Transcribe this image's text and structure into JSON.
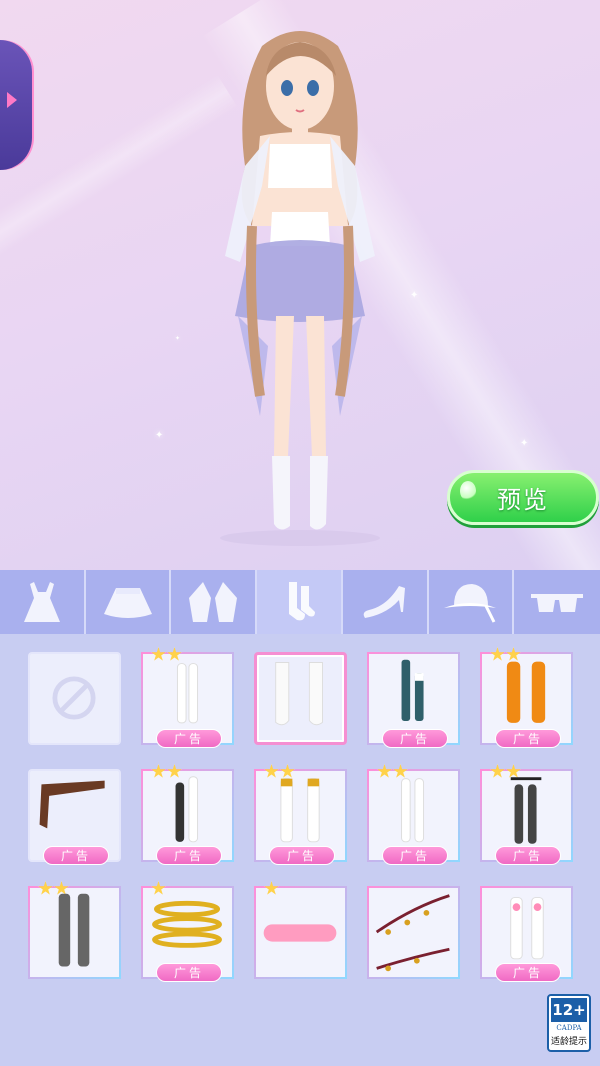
{
  "preview_button": {
    "label": "预览"
  },
  "tabs": [
    {
      "icon": "dress-icon",
      "active": false
    },
    {
      "icon": "skirt-icon",
      "active": false
    },
    {
      "icon": "jacket-icon",
      "active": false
    },
    {
      "icon": "socks-icon",
      "active": true
    },
    {
      "icon": "high-heel-icon",
      "active": false
    },
    {
      "icon": "sun-hat-icon",
      "active": false
    },
    {
      "icon": "sunglasses-icon",
      "active": false
    }
  ],
  "items": [
    {
      "kind": "none",
      "stars": 0,
      "ad": ""
    },
    {
      "kind": "white-lace-stockings",
      "stars": 2,
      "ad": "广告"
    },
    {
      "kind": "white-ankle-socks",
      "stars": 0,
      "ad": "",
      "selected": true
    },
    {
      "kind": "teal-mismatched-socks",
      "stars": 0,
      "ad": "广告"
    },
    {
      "kind": "orange-socks",
      "stars": 2,
      "ad": "广告"
    },
    {
      "kind": "brown-leg-ribbon",
      "stars": 0,
      "ad": "广告"
    },
    {
      "kind": "black-white-stockings",
      "stars": 2,
      "ad": "广告"
    },
    {
      "kind": "gold-band-stockings",
      "stars": 2,
      "ad": "广告"
    },
    {
      "kind": "cross-lace-stockings",
      "stars": 2,
      "ad": "广告"
    },
    {
      "kind": "black-garter-stockings",
      "stars": 2,
      "ad": "广告"
    },
    {
      "kind": "gray-tights",
      "stars": 2,
      "ad": ""
    },
    {
      "kind": "gold-spiral-anklet",
      "stars": 1,
      "ad": "广告"
    },
    {
      "kind": "pink-heart-anklet",
      "stars": 1,
      "ad": ""
    },
    {
      "kind": "bell-anklet",
      "stars": 0,
      "ad": ""
    },
    {
      "kind": "pink-bow-socks",
      "stars": 0,
      "ad": "广告"
    }
  ],
  "age_rating": {
    "number": "12+",
    "org": "CADPA",
    "tip": "适龄提示"
  }
}
